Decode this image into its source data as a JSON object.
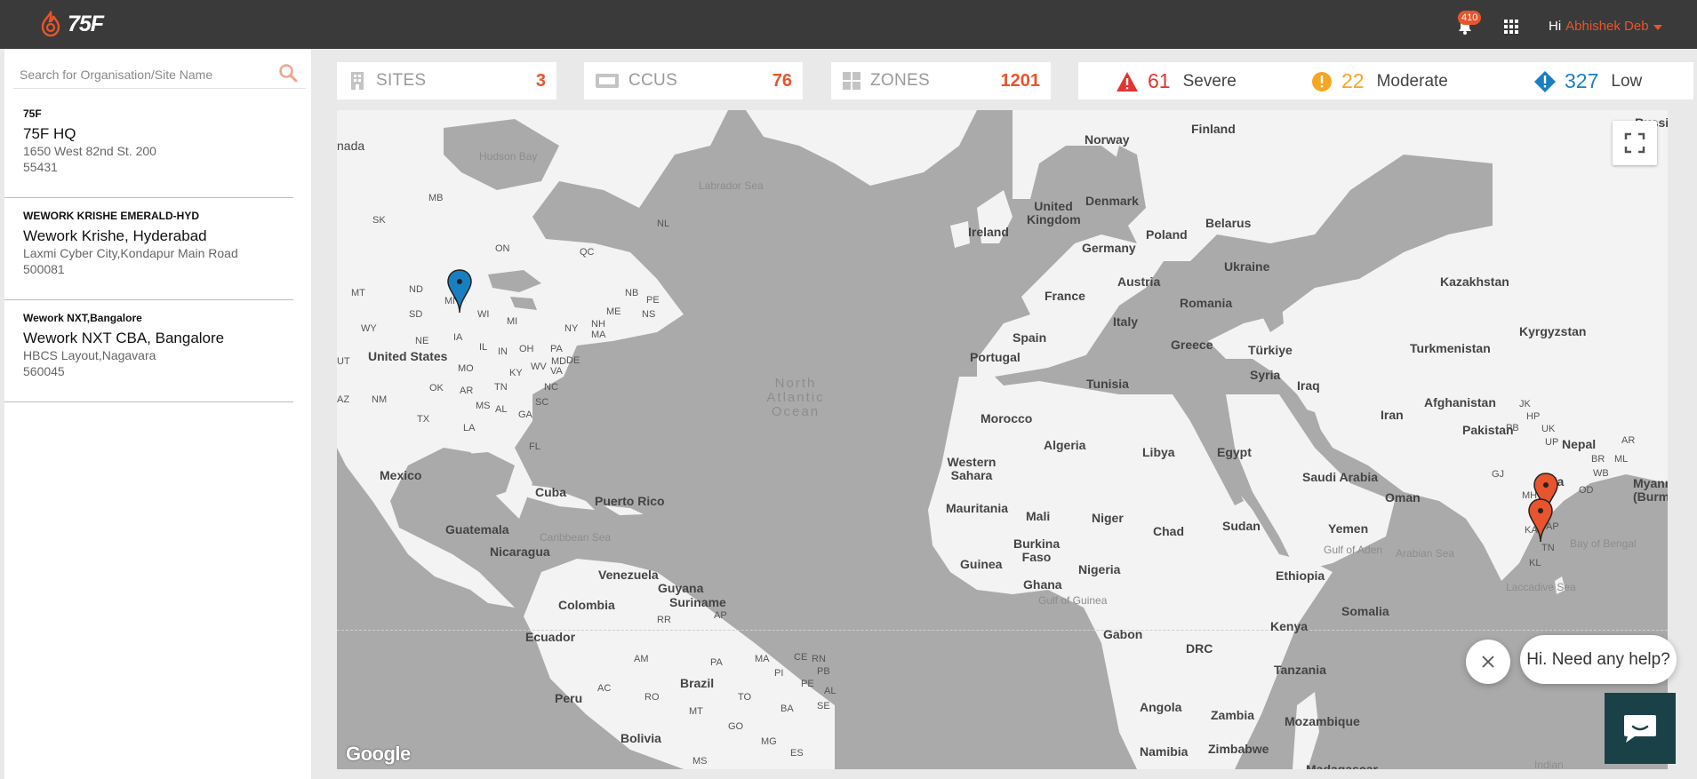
{
  "header": {
    "logo_text": "75F",
    "notifications_count": "410",
    "greeting": "Hi",
    "user_name": "Abhishek Deb"
  },
  "sidebar": {
    "search_placeholder": "Search for Organisation/Site Name",
    "sites": [
      {
        "org": "75F",
        "name": "75F HQ",
        "address": "1650 West 82nd St. 200",
        "zip": "55431"
      },
      {
        "org": "WEWORK KRISHE EMERALD-HYD",
        "name": "Wework Krishe, Hyderabad",
        "address": "Laxmi Cyber City,Kondapur Main Road",
        "zip": "500081"
      },
      {
        "org": "Wework NXT,Bangalore",
        "name": "Wework NXT CBA, Bangalore",
        "address": "HBCS Layout,Nagavara",
        "zip": "560045"
      }
    ]
  },
  "stats": {
    "sites": {
      "label": "SITES",
      "value": "3"
    },
    "ccus": {
      "label": "CCUS",
      "value": "76"
    },
    "zones": {
      "label": "ZONES",
      "value": "1201"
    }
  },
  "alerts": {
    "severe": {
      "count": "61",
      "label": "Severe",
      "color": "#e3342f"
    },
    "moderate": {
      "count": "22",
      "label": "Moderate",
      "color": "#f5a623"
    },
    "low": {
      "count": "327",
      "label": "Low",
      "color": "#1a7fc1"
    }
  },
  "map": {
    "attribution": "Google",
    "labels": {
      "canada": "nada",
      "hudson": "Hudson Bay",
      "labrador": "Labrador Sea",
      "mb": "MB",
      "sk": "SK",
      "on": "ON",
      "qc": "QC",
      "nl": "NL",
      "nb": "NB",
      "pe": "PE",
      "ns": "NS",
      "me": "ME",
      "nh": "NH",
      "ma": "MA",
      "ny": "NY",
      "mi": "MI",
      "wi": "WI",
      "mt": "MT",
      "nd": "ND",
      "sd": "SD",
      "wy": "WY",
      "ne": "NE",
      "ia": "IA",
      "il": "IL",
      "in": "IN",
      "oh": "OH",
      "pa": "PA",
      "de": "DE",
      "md": "MD",
      "ut": "UT",
      "mo": "MO",
      "ky": "KY",
      "wv": "WV",
      "va": "VA",
      "nc": "NC",
      "tn": "TN",
      "ar": "AR",
      "ok": "OK",
      "sc": "SC",
      "az": "AZ",
      "nm": "NM",
      "ms": "MS",
      "al": "AL",
      "ga": "GA",
      "tx": "TX",
      "la": "LA",
      "fl": "FL",
      "mn": "MN",
      "us": "United States",
      "mexico": "Mexico",
      "cuba": "Cuba",
      "puerto": "Puerto Rico",
      "guatemala": "Guatemala",
      "nicaragua": "Nicaragua",
      "caribbean": "Caribbean Sea",
      "venezuela": "Venezuela",
      "guyana": "Guyana",
      "suriname": "Suriname",
      "colombia": "Colombia",
      "ap": "AP",
      "rr": "RR",
      "ecuador": "Ecuador",
      "am": "AM",
      "pa_br": "PA",
      "ma_br": "MA",
      "ce": "CE",
      "rn": "RN",
      "pi": "PI",
      "pb": "PB",
      "pe_br": "PE",
      "al_br": "AL",
      "se": "SE",
      "ac": "AC",
      "ro": "RO",
      "brazil": "Brazil",
      "peru": "Peru",
      "to": "TO",
      "ba": "BA",
      "mt_br": "MT",
      "go": "GO",
      "mg": "MG",
      "es": "ES",
      "bolivia": "Bolivia",
      "ms_br": "MS",
      "north_atlantic": "North Atlantic Ocean",
      "norway": "Norway",
      "finland": "Finland",
      "uk": "United Kingdom",
      "denmark": "Denmark",
      "ireland": "Ireland",
      "poland": "Poland",
      "belarus": "Belarus",
      "germany": "Germany",
      "ukraine": "Ukraine",
      "france": "France",
      "austria": "Austria",
      "romania": "Romania",
      "kazakhstan": "Kazakhstan",
      "spain": "Spain",
      "italy": "Italy",
      "kyrgyzstan": "Kyrgyzstan",
      "portugal": "Portugal",
      "greece": "Greece",
      "turkiye": "Türkiye",
      "turkmenistan": "Turkmenistan",
      "tunisia": "Tunisia",
      "syria": "Syria",
      "iraq": "Iraq",
      "iran": "Iran",
      "afghanistan": "Afghanistan",
      "morocco": "Morocco",
      "pakistan": "Pakistan",
      "algeria": "Algeria",
      "libya": "Libya",
      "egypt": "Egypt",
      "nepal": "Nepal",
      "w_sahara": "Western Sahara",
      "saudi": "Saudi Arabia",
      "india": "dia",
      "oman": "Oman",
      "mauritania": "Mauritania",
      "mali": "Mali",
      "niger": "Niger",
      "chad": "Chad",
      "sudan": "Sudan",
      "yemen": "Yemen",
      "burkina": "Burkina Faso",
      "guinea": "Guinea",
      "nigeria": "Nigeria",
      "ethiopia": "Ethiopia",
      "ghana": "Ghana",
      "gulf_aden": "Gulf of Aden",
      "arabian": "Arabian Sea",
      "bengal": "Bay of Bengal",
      "laccadive": "Laccadive Sea",
      "gulf_guinea": "Gulf of Guinea",
      "somalia": "Somalia",
      "kenya": "Kenya",
      "gabon": "Gabon",
      "drc": "DRC",
      "tanzania": "Tanzania",
      "angola": "Angola",
      "zambia": "Zambia",
      "mozambique": "Mozambique",
      "namibia": "Namibia",
      "zimbabwe": "Zimbabwe",
      "madagascar": "Madagascar",
      "indian": "Indian",
      "myanmar": "Myanmar (Burm",
      "jk": "JK",
      "hp": "HP",
      "pb_in": "PB",
      "uk_in": "UK",
      "up": "UP",
      "ar_in": "AR",
      "br": "BR",
      "ml": "ML",
      "wb": "WB",
      "gj": "GJ",
      "od": "OD",
      "mh": "MH",
      "ka": "KA",
      "ap_in": "AP",
      "tn_in": "TN",
      "kl": "KL",
      "russia": "Russia"
    }
  },
  "chat": {
    "prompt": "Hi. Need any help?"
  }
}
